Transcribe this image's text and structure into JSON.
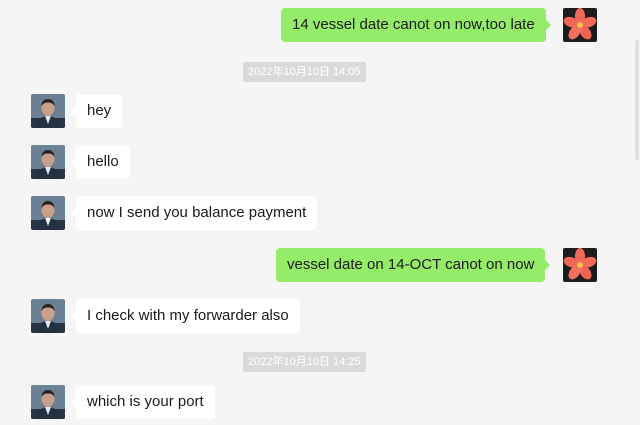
{
  "messages": [
    {
      "type": "outgoing",
      "text": "14 vessel date canot on now,too late",
      "avatar": "flower-avatar"
    },
    {
      "type": "timestamp",
      "text": "2022年10月10日 14:05"
    },
    {
      "type": "incoming",
      "text": "hey",
      "avatar": "contact-avatar"
    },
    {
      "type": "incoming",
      "text": "hello",
      "avatar": "contact-avatar"
    },
    {
      "type": "incoming",
      "text": "now I send you balance payment",
      "avatar": "contact-avatar"
    },
    {
      "type": "outgoing",
      "text": "vessel date on 14-OCT canot on now",
      "avatar": "flower-avatar"
    },
    {
      "type": "incoming",
      "text": "I check with my forwarder also",
      "avatar": "contact-avatar"
    },
    {
      "type": "timestamp",
      "text": "2022年10月10日 14:25"
    },
    {
      "type": "incoming",
      "text": "which is your port",
      "avatar": "contact-avatar"
    }
  ],
  "colors": {
    "background": "#f5f5f5",
    "incoming_bubble": "#ffffff",
    "outgoing_bubble": "#95ec69",
    "timestamp_bg": "#dadada"
  }
}
